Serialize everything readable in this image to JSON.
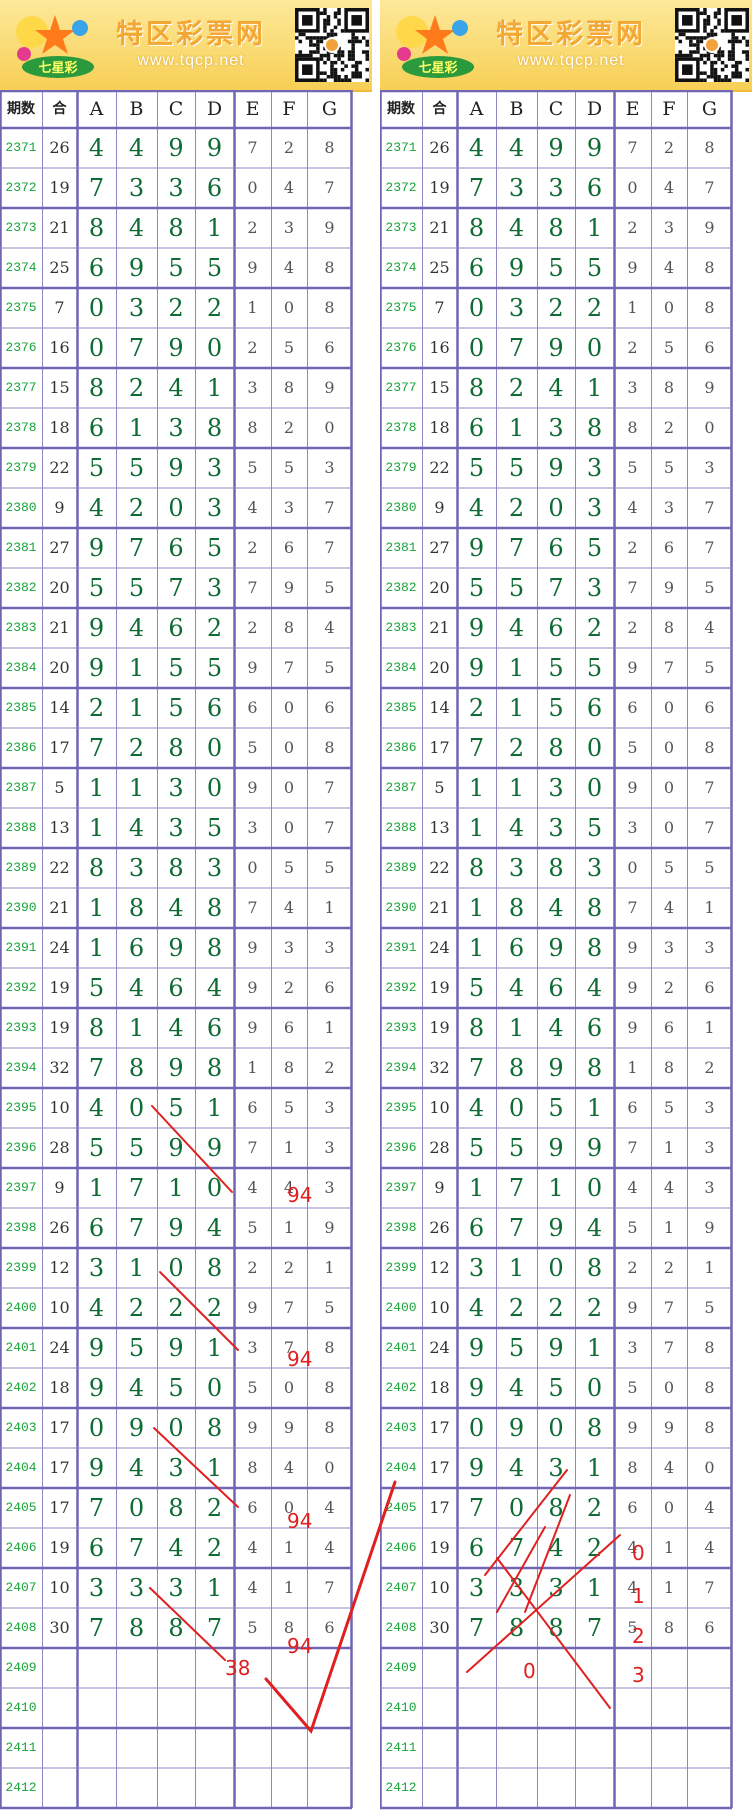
{
  "banner": {
    "title": "特区彩票网",
    "url": "www.tqcp.net",
    "logo_text": "七星彩"
  },
  "headers": [
    "期数",
    "合",
    "A",
    "B",
    "C",
    "D",
    "E",
    "F",
    "G"
  ],
  "rows": [
    {
      "issue": "2371",
      "sum": "26",
      "abcd": [
        "4",
        "4",
        "9",
        "9"
      ],
      "efg": [
        "7",
        "2",
        "8"
      ]
    },
    {
      "issue": "2372",
      "sum": "19",
      "abcd": [
        "7",
        "3",
        "3",
        "6"
      ],
      "efg": [
        "0",
        "4",
        "7"
      ]
    },
    {
      "issue": "2373",
      "sum": "21",
      "abcd": [
        "8",
        "4",
        "8",
        "1"
      ],
      "efg": [
        "2",
        "3",
        "9"
      ]
    },
    {
      "issue": "2374",
      "sum": "25",
      "abcd": [
        "6",
        "9",
        "5",
        "5"
      ],
      "efg": [
        "9",
        "4",
        "8"
      ]
    },
    {
      "issue": "2375",
      "sum": "7",
      "abcd": [
        "0",
        "3",
        "2",
        "2"
      ],
      "efg": [
        "1",
        "0",
        "8"
      ]
    },
    {
      "issue": "2376",
      "sum": "16",
      "abcd": [
        "0",
        "7",
        "9",
        "0"
      ],
      "efg": [
        "2",
        "5",
        "6"
      ]
    },
    {
      "issue": "2377",
      "sum": "15",
      "abcd": [
        "8",
        "2",
        "4",
        "1"
      ],
      "efg": [
        "3",
        "8",
        "9"
      ]
    },
    {
      "issue": "2378",
      "sum": "18",
      "abcd": [
        "6",
        "1",
        "3",
        "8"
      ],
      "efg": [
        "8",
        "2",
        "0"
      ]
    },
    {
      "issue": "2379",
      "sum": "22",
      "abcd": [
        "5",
        "5",
        "9",
        "3"
      ],
      "efg": [
        "5",
        "5",
        "3"
      ]
    },
    {
      "issue": "2380",
      "sum": "9",
      "abcd": [
        "4",
        "2",
        "0",
        "3"
      ],
      "efg": [
        "4",
        "3",
        "7"
      ]
    },
    {
      "issue": "2381",
      "sum": "27",
      "abcd": [
        "9",
        "7",
        "6",
        "5"
      ],
      "efg": [
        "2",
        "6",
        "7"
      ]
    },
    {
      "issue": "2382",
      "sum": "20",
      "abcd": [
        "5",
        "5",
        "7",
        "3"
      ],
      "efg": [
        "7",
        "9",
        "5"
      ]
    },
    {
      "issue": "2383",
      "sum": "21",
      "abcd": [
        "9",
        "4",
        "6",
        "2"
      ],
      "efg": [
        "2",
        "8",
        "4"
      ]
    },
    {
      "issue": "2384",
      "sum": "20",
      "abcd": [
        "9",
        "1",
        "5",
        "5"
      ],
      "efg": [
        "9",
        "7",
        "5"
      ]
    },
    {
      "issue": "2385",
      "sum": "14",
      "abcd": [
        "2",
        "1",
        "5",
        "6"
      ],
      "efg": [
        "6",
        "0",
        "6"
      ]
    },
    {
      "issue": "2386",
      "sum": "17",
      "abcd": [
        "7",
        "2",
        "8",
        "0"
      ],
      "efg": [
        "5",
        "0",
        "8"
      ]
    },
    {
      "issue": "2387",
      "sum": "5",
      "abcd": [
        "1",
        "1",
        "3",
        "0"
      ],
      "efg": [
        "9",
        "0",
        "7"
      ]
    },
    {
      "issue": "2388",
      "sum": "13",
      "abcd": [
        "1",
        "4",
        "3",
        "5"
      ],
      "efg": [
        "3",
        "0",
        "7"
      ]
    },
    {
      "issue": "2389",
      "sum": "22",
      "abcd": [
        "8",
        "3",
        "8",
        "3"
      ],
      "efg": [
        "0",
        "5",
        "5"
      ]
    },
    {
      "issue": "2390",
      "sum": "21",
      "abcd": [
        "1",
        "8",
        "4",
        "8"
      ],
      "efg": [
        "7",
        "4",
        "1"
      ]
    },
    {
      "issue": "2391",
      "sum": "24",
      "abcd": [
        "1",
        "6",
        "9",
        "8"
      ],
      "efg": [
        "9",
        "3",
        "3"
      ]
    },
    {
      "issue": "2392",
      "sum": "19",
      "abcd": [
        "5",
        "4",
        "6",
        "4"
      ],
      "efg": [
        "9",
        "2",
        "6"
      ]
    },
    {
      "issue": "2393",
      "sum": "19",
      "abcd": [
        "8",
        "1",
        "4",
        "6"
      ],
      "efg": [
        "9",
        "6",
        "1"
      ]
    },
    {
      "issue": "2394",
      "sum": "32",
      "abcd": [
        "7",
        "8",
        "9",
        "8"
      ],
      "efg": [
        "1",
        "8",
        "2"
      ]
    },
    {
      "issue": "2395",
      "sum": "10",
      "abcd": [
        "4",
        "0",
        "5",
        "1"
      ],
      "efg": [
        "6",
        "5",
        "3"
      ]
    },
    {
      "issue": "2396",
      "sum": "28",
      "abcd": [
        "5",
        "5",
        "9",
        "9"
      ],
      "efg": [
        "7",
        "1",
        "3"
      ]
    },
    {
      "issue": "2397",
      "sum": "9",
      "abcd": [
        "1",
        "7",
        "1",
        "0"
      ],
      "efg": [
        "4",
        "4",
        "3"
      ]
    },
    {
      "issue": "2398",
      "sum": "26",
      "abcd": [
        "6",
        "7",
        "9",
        "4"
      ],
      "efg": [
        "5",
        "1",
        "9"
      ]
    },
    {
      "issue": "2399",
      "sum": "12",
      "abcd": [
        "3",
        "1",
        "0",
        "8"
      ],
      "efg": [
        "2",
        "2",
        "1"
      ]
    },
    {
      "issue": "2400",
      "sum": "10",
      "abcd": [
        "4",
        "2",
        "2",
        "2"
      ],
      "efg": [
        "9",
        "7",
        "5"
      ]
    },
    {
      "issue": "2401",
      "sum": "24",
      "abcd": [
        "9",
        "5",
        "9",
        "1"
      ],
      "efg": [
        "3",
        "7",
        "8"
      ]
    },
    {
      "issue": "2402",
      "sum": "18",
      "abcd": [
        "9",
        "4",
        "5",
        "0"
      ],
      "efg": [
        "5",
        "0",
        "8"
      ]
    },
    {
      "issue": "2403",
      "sum": "17",
      "abcd": [
        "0",
        "9",
        "0",
        "8"
      ],
      "efg": [
        "9",
        "9",
        "8"
      ]
    },
    {
      "issue": "2404",
      "sum": "17",
      "abcd": [
        "9",
        "4",
        "3",
        "1"
      ],
      "efg": [
        "8",
        "4",
        "0"
      ]
    },
    {
      "issue": "2405",
      "sum": "17",
      "abcd": [
        "7",
        "0",
        "8",
        "2"
      ],
      "efg": [
        "6",
        "0",
        "4"
      ]
    },
    {
      "issue": "2406",
      "sum": "19",
      "abcd": [
        "6",
        "7",
        "4",
        "2"
      ],
      "efg": [
        "4",
        "1",
        "4"
      ]
    },
    {
      "issue": "2407",
      "sum": "10",
      "abcd": [
        "3",
        "3",
        "3",
        "1"
      ],
      "efg": [
        "4",
        "1",
        "7"
      ]
    },
    {
      "issue": "2408",
      "sum": "30",
      "abcd": [
        "7",
        "8",
        "8",
        "7"
      ],
      "efg": [
        "5",
        "8",
        "6"
      ]
    },
    {
      "issue": "2409",
      "sum": "",
      "abcd": [
        "",
        "",
        "",
        ""
      ],
      "efg": [
        "",
        "",
        ""
      ]
    },
    {
      "issue": "2410",
      "sum": "",
      "abcd": [
        "",
        "",
        "",
        ""
      ],
      "efg": [
        "",
        "",
        ""
      ]
    },
    {
      "issue": "2411",
      "sum": "",
      "abcd": [
        "",
        "",
        "",
        ""
      ],
      "efg": [
        "",
        "",
        ""
      ]
    },
    {
      "issue": "2412",
      "sum": "",
      "abcd": [
        "",
        "",
        "",
        ""
      ],
      "efg": [
        "",
        "",
        ""
      ]
    }
  ],
  "annotations_left": [
    "94",
    "94",
    "94",
    "94",
    "38"
  ],
  "annotations_right": [
    "0",
    "1",
    "2",
    "3",
    "0"
  ],
  "colors": {
    "grid_line": "#8e88c4",
    "grid_bold": "#6f67b3",
    "issue_text": "#1aa33a",
    "big_digit": "#0e6b33",
    "annotation": "#e02020"
  }
}
